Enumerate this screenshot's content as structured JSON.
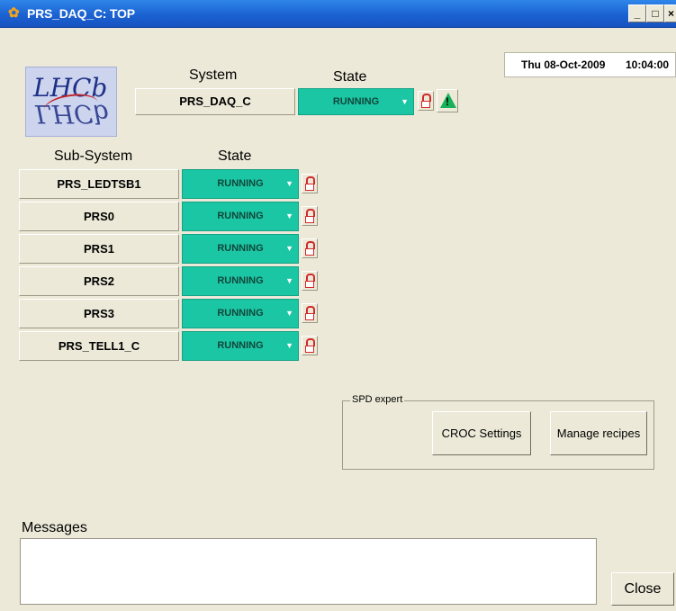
{
  "window": {
    "title": "PRS_DAQ_C: TOP",
    "minimize": "_",
    "maximize": "□",
    "close": "×"
  },
  "logo": {
    "line1": "LHCb",
    "line2": "LHCb"
  },
  "header": {
    "system_label": "System",
    "state_label": "State",
    "system_name": "PRS_DAQ_C",
    "system_state": "RUNNING"
  },
  "datetime": {
    "date": "Thu 08-Oct-2009",
    "time": "10:04:00"
  },
  "subsystems": {
    "col_name": "Sub-System",
    "col_state": "State",
    "rows": [
      {
        "name": "PRS_LEDTSB1",
        "state": "RUNNING"
      },
      {
        "name": "PRS0",
        "state": "RUNNING"
      },
      {
        "name": "PRS1",
        "state": "RUNNING"
      },
      {
        "name": "PRS2",
        "state": "RUNNING"
      },
      {
        "name": "PRS3",
        "state": "RUNNING"
      },
      {
        "name": "PRS_TELL1_C",
        "state": "RUNNING"
      }
    ]
  },
  "spd_expert": {
    "legend": "SPD expert",
    "croc_button": "CROC Settings",
    "recipes_button": "Manage recipes"
  },
  "messages": {
    "label": "Messages"
  },
  "close_button": "Close",
  "colors": {
    "state_running": "#1bc6a4",
    "titlebar": "#1b62d1"
  },
  "icons": [
    "app-gear-icon",
    "lock-icon",
    "warning-icon",
    "dropdown-arrow-icon"
  ]
}
